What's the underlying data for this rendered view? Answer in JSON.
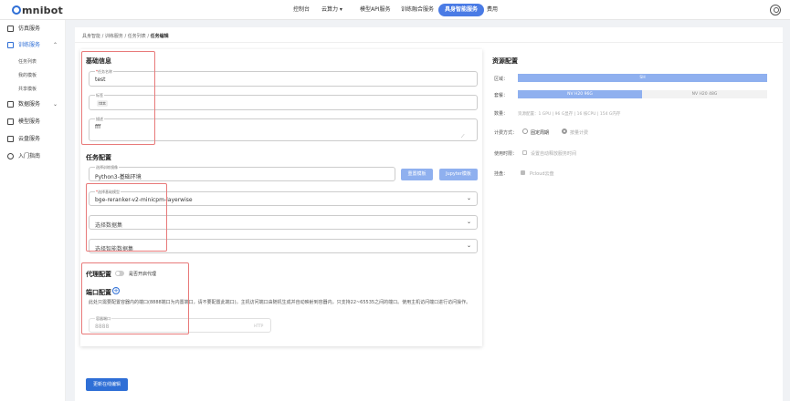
{
  "brand": {
    "name": "mnibot"
  },
  "topnav": {
    "items": [
      "控制台",
      "云算力",
      "模型API服务",
      "训练融合服务",
      "具身智能服务",
      "费用"
    ]
  },
  "sidebar": {
    "items": [
      "仿真服务",
      "训练服务",
      "数据服务",
      "模型服务",
      "云盘服务",
      "入门指南"
    ],
    "sub_items": [
      "任务列表",
      "我的模板",
      "共享模板"
    ]
  },
  "breadcrumb": {
    "items": [
      "具身智能",
      "训练服务",
      "任务列表"
    ],
    "current": "任务编辑"
  },
  "basic_info": {
    "title": "基础信息",
    "task_name_label": "任务名称",
    "task_name_value": "test",
    "tags_label": "标签",
    "tag_value": "ttttt",
    "desc_label": "描述",
    "desc_value": "fff"
  },
  "task_config": {
    "title": "任务配置",
    "image_label": "选择训练镜像",
    "image_value": "Python3-基础环境",
    "reset_button": "重置模板",
    "jupyter_button": "Jupyter模板",
    "model_label": "选择基础模型",
    "model_value": "bge-reranker-v2-minicpm-layerwise",
    "dataset_placeholder": "选择数据集",
    "smart_dataset_placeholder": "选择智能数据集"
  },
  "proxy_config": {
    "title": "代理配置",
    "toggle_label": "是否开启代理"
  },
  "port_config": {
    "title": "端口配置",
    "description": "此处只需要配置容器内的端口(8888端口为内置端口，请不要配置此端口)。主机访问端口由随机生成并自动映射到容器内，只支持22~65535之间的端口。使用主机访问端口进行访问操作。",
    "port_label": "容器端口",
    "port_value": "8888",
    "port_protocol": "HTTP"
  },
  "resource_config": {
    "title": "资源配置",
    "region_label": "区域：",
    "region_value": "SH",
    "gpu_label": "套餐：",
    "gpu_options": [
      "NV H20 96G",
      "NV H20 48G"
    ],
    "count_label": "数量：",
    "count_value": "资源配置：1 GPU | 96 G显存 | 16 核CPU | 154 G内存",
    "billing_label": "计费方式：",
    "billing_options": [
      "固定周期",
      "按量计费"
    ],
    "hook_label": "使用时限：",
    "hook_value": "设置自动释放服务时间",
    "mount_label": "挂盘：",
    "mount_value": "Pcloud云盘"
  },
  "footer": {
    "update_button": "更新在线编辑"
  }
}
